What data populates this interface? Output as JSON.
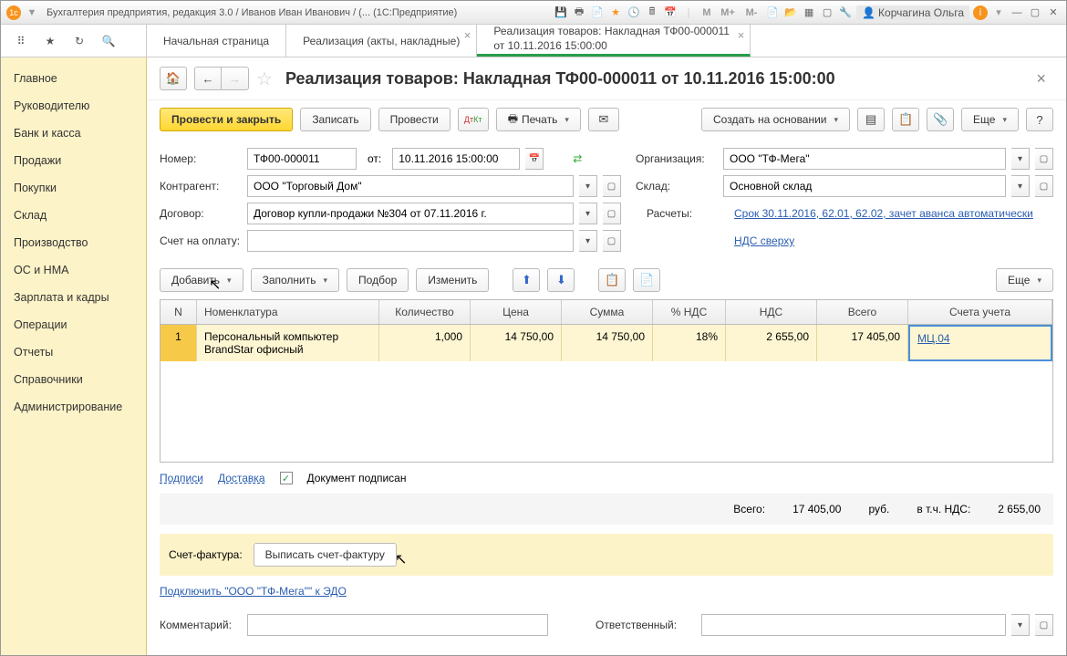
{
  "titlebar": {
    "title": "Бухгалтерия предприятия, редакция 3.0 / Иванов Иван Иванович / (...  (1С:Предприятие)",
    "user": "Корчагина Ольга",
    "m_buttons": [
      "M",
      "M+",
      "M-"
    ]
  },
  "tabs": [
    {
      "label": "Начальная страница",
      "closable": false
    },
    {
      "label": "Реализация (акты, накладные)",
      "closable": true
    },
    {
      "label": "Реализация товаров: Накладная ТФ00-000011 от 10.11.2016 15:00:00",
      "closable": true,
      "active": true
    }
  ],
  "sidebar": [
    "Главное",
    "Руководителю",
    "Банк и касса",
    "Продажи",
    "Покупки",
    "Склад",
    "Производство",
    "ОС и НМА",
    "Зарплата и кадры",
    "Операции",
    "Отчеты",
    "Справочники",
    "Администрирование"
  ],
  "doc": {
    "title": "Реализация товаров: Накладная ТФ00-000011 от 10.11.2016 15:00:00",
    "actions": {
      "post_close": "Провести и закрыть",
      "save": "Записать",
      "post": "Провести",
      "print": "Печать",
      "create_based": "Создать на основании",
      "more": "Еще"
    },
    "fields": {
      "number_lbl": "Номер:",
      "number": "ТФ00-000011",
      "from_lbl": "от:",
      "date": "10.11.2016 15:00:00",
      "org_lbl": "Организация:",
      "org": "ООО \"ТФ-Мега\"",
      "contr_lbl": "Контрагент:",
      "contr": "ООО \"Торговый Дом\"",
      "wh_lbl": "Склад:",
      "wh": "Основной склад",
      "contract_lbl": "Договор:",
      "contract": "Договор купли-продажи №304 от 07.11.2016 г.",
      "calc_lbl": "Расчеты:",
      "calc_link": "Срок 30.11.2016, 62.01, 62.02, зачет аванса автоматически",
      "invoice_order_lbl": "Счет на оплату:",
      "vat_link": "НДС сверху"
    },
    "table_actions": {
      "add": "Добавить",
      "fill": "Заполнить",
      "select": "Подбор",
      "change": "Изменить",
      "more": "Еще"
    },
    "columns": [
      "N",
      "Номенклатура",
      "Количество",
      "Цена",
      "Сумма",
      "% НДС",
      "НДС",
      "Всего",
      "Счета учета"
    ],
    "rows": [
      {
        "n": "1",
        "nom": "Персональный компьютер BrandStar офисный",
        "qty": "1,000",
        "price": "14 750,00",
        "sum": "14 750,00",
        "vat": "18%",
        "vatamt": "2 655,00",
        "total": "17 405,00",
        "acc": "МЦ.04"
      }
    ],
    "footer": {
      "sign": "Подписи",
      "delivery": "Доставка",
      "signed": "Документ подписан",
      "total_lbl": "Всего:",
      "total": "17 405,00",
      "rub": "руб.",
      "vat_lbl": "в т.ч. НДС:",
      "vat": "2 655,00",
      "invoice_lbl": "Счет-фактура:",
      "invoice_btn": "Выписать счет-фактуру",
      "edo": "Подключить \"ООО \"ТФ-Мега\"\" к ЭДО",
      "comment_lbl": "Комментарий:",
      "resp_lbl": "Ответственный:"
    }
  }
}
